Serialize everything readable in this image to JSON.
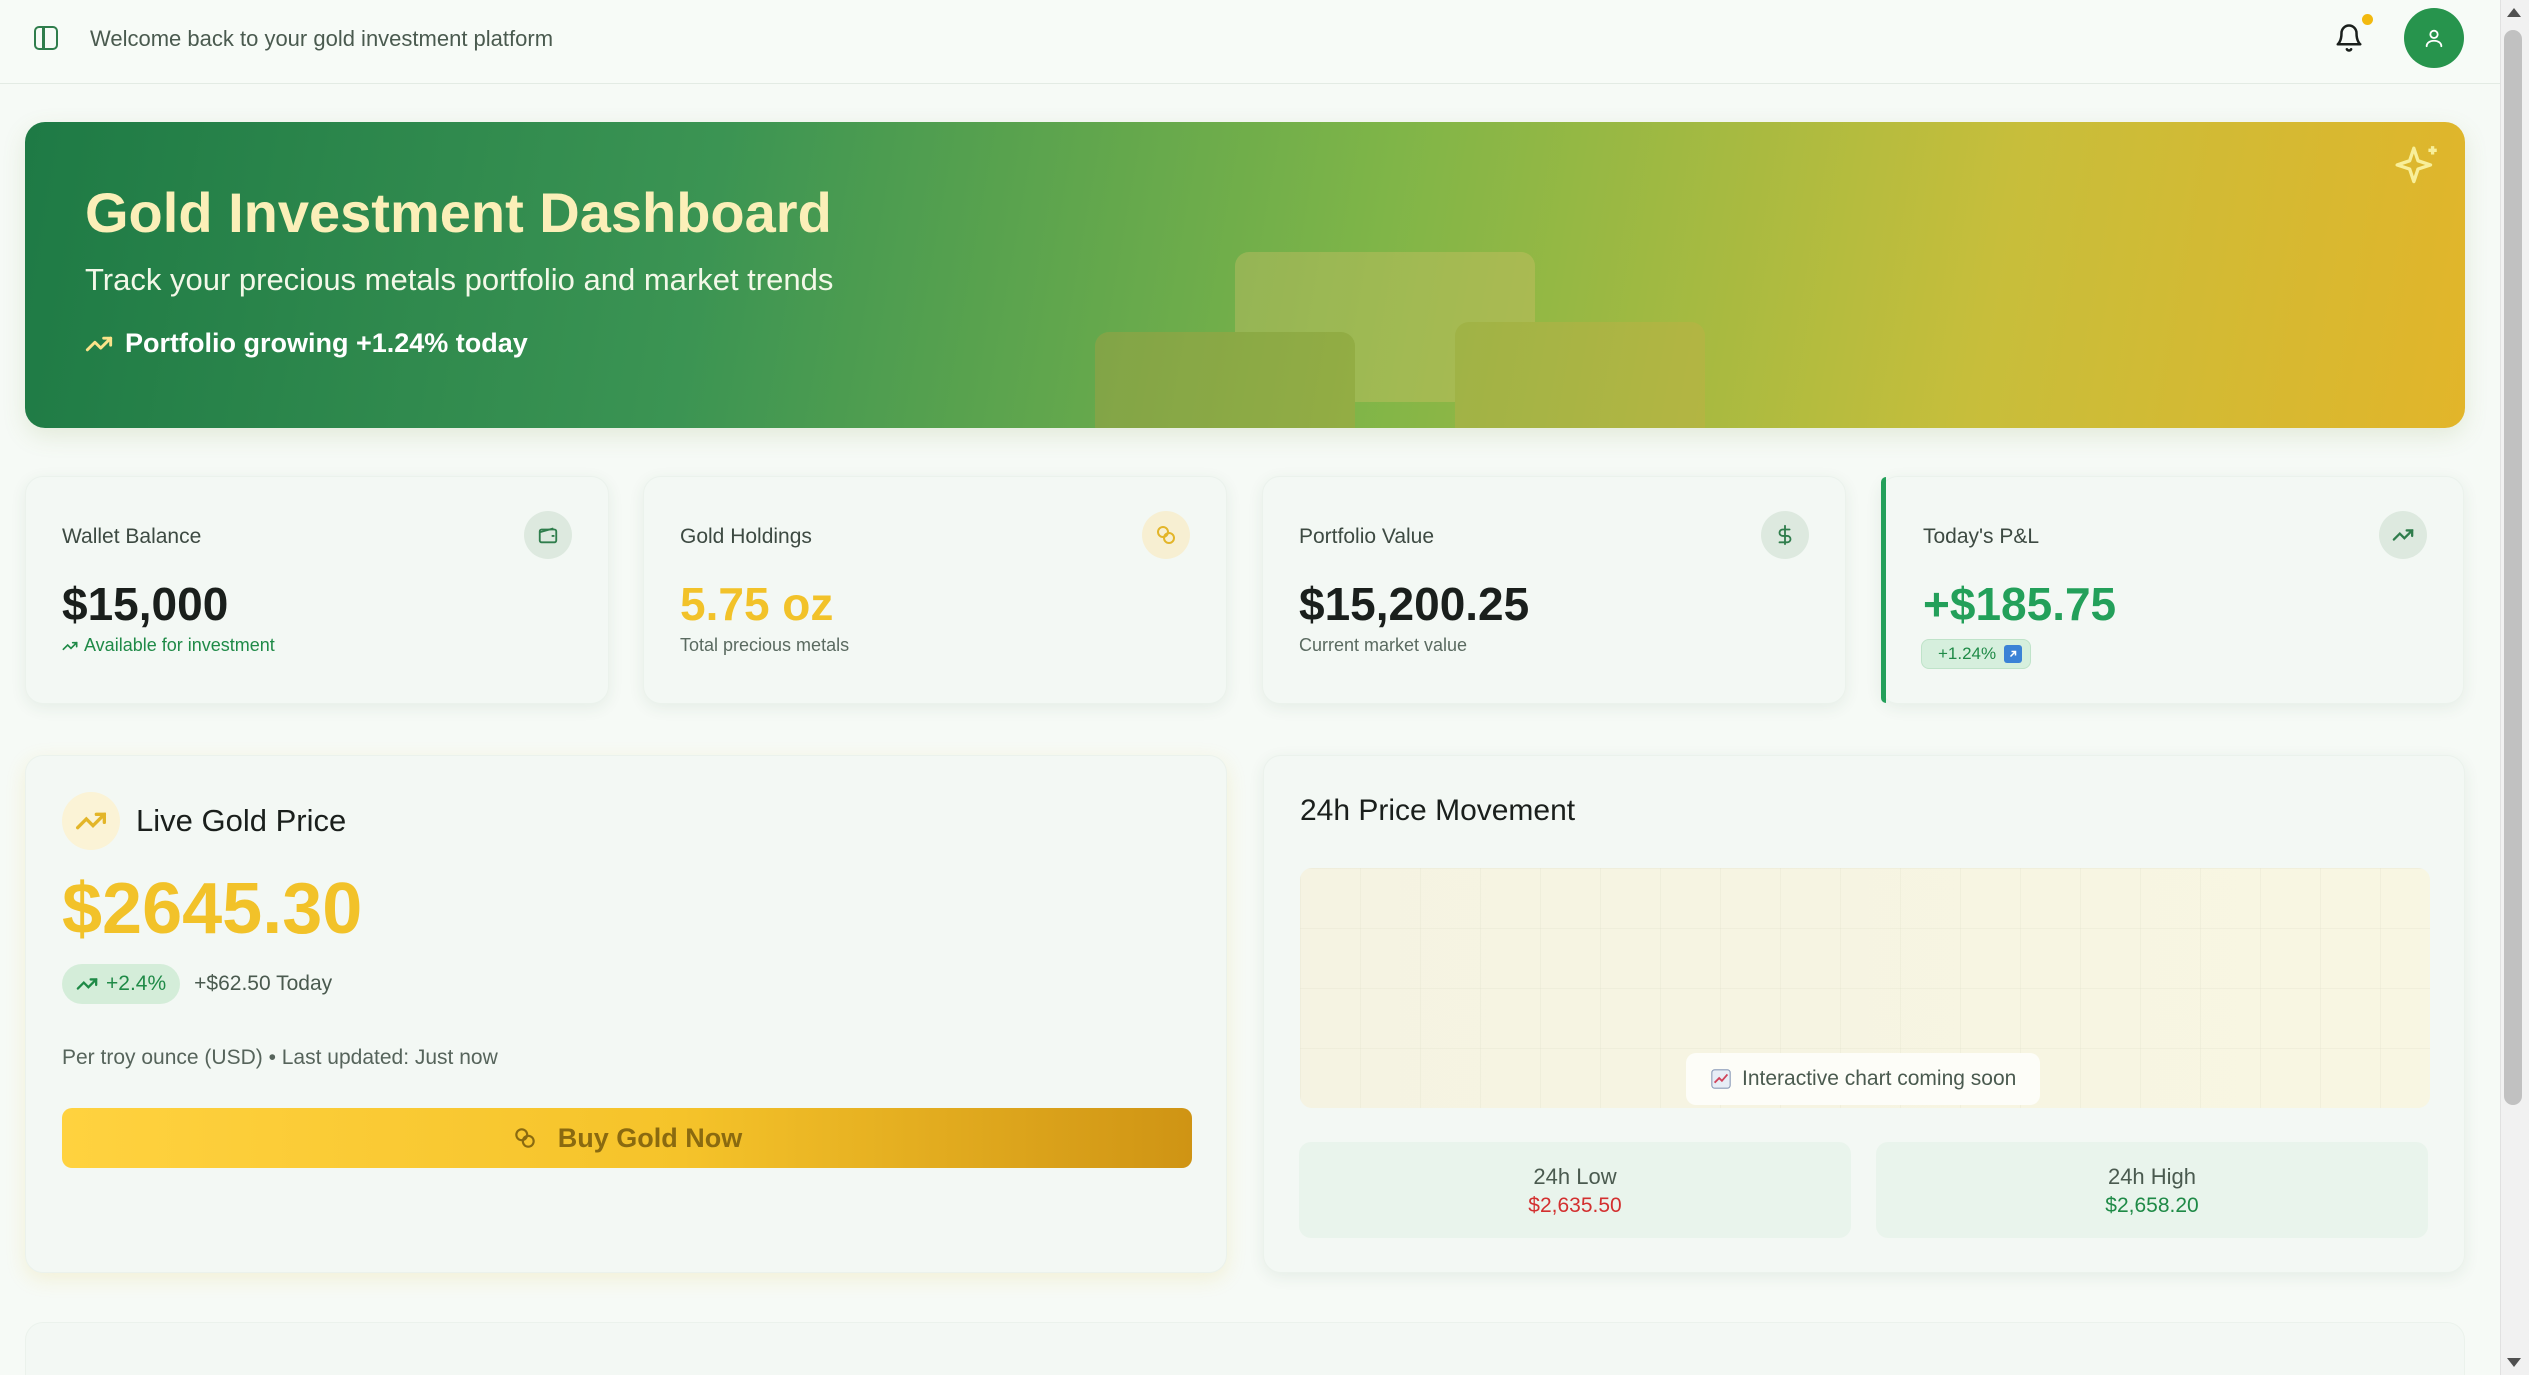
{
  "header": {
    "welcome": "Welcome back to your gold investment platform"
  },
  "hero": {
    "title": "Gold Investment Dashboard",
    "subtitle": "Track your precious metals portfolio and market trends",
    "growth": "Portfolio growing +1.24% today"
  },
  "stats": [
    {
      "label": "Wallet Balance",
      "value": "$15,000",
      "sub": "Available for investment",
      "icon": "wallet-icon"
    },
    {
      "label": "Gold Holdings",
      "value": "5.75 oz",
      "sub": "Total precious metals",
      "icon": "coins-icon"
    },
    {
      "label": "Portfolio Value",
      "value": "$15,200.25",
      "sub": "Current market value",
      "icon": "dollar-icon"
    },
    {
      "label": "Today's P&L",
      "value": "+$185.75",
      "sub": "+1.24%",
      "icon": "trending-up-icon"
    }
  ],
  "live": {
    "title": "Live Gold Price",
    "price": "$2645.30",
    "change_pct": "+2.4%",
    "change_today": "+$62.50 Today",
    "note": "Per troy ounce (USD) • Last updated: Just now",
    "buy_label": "Buy Gold Now"
  },
  "movement": {
    "title": "24h Price Movement",
    "chart_placeholder": "Interactive chart coming soon",
    "low_label": "24h Low",
    "low_value": "$2,635.50",
    "high_label": "24h High",
    "high_value": "$2,658.20"
  },
  "colors": {
    "brand_green": "#27944d",
    "gold": "#f2c229",
    "low_red": "#d32f2f",
    "high_green": "#1f8a47"
  }
}
